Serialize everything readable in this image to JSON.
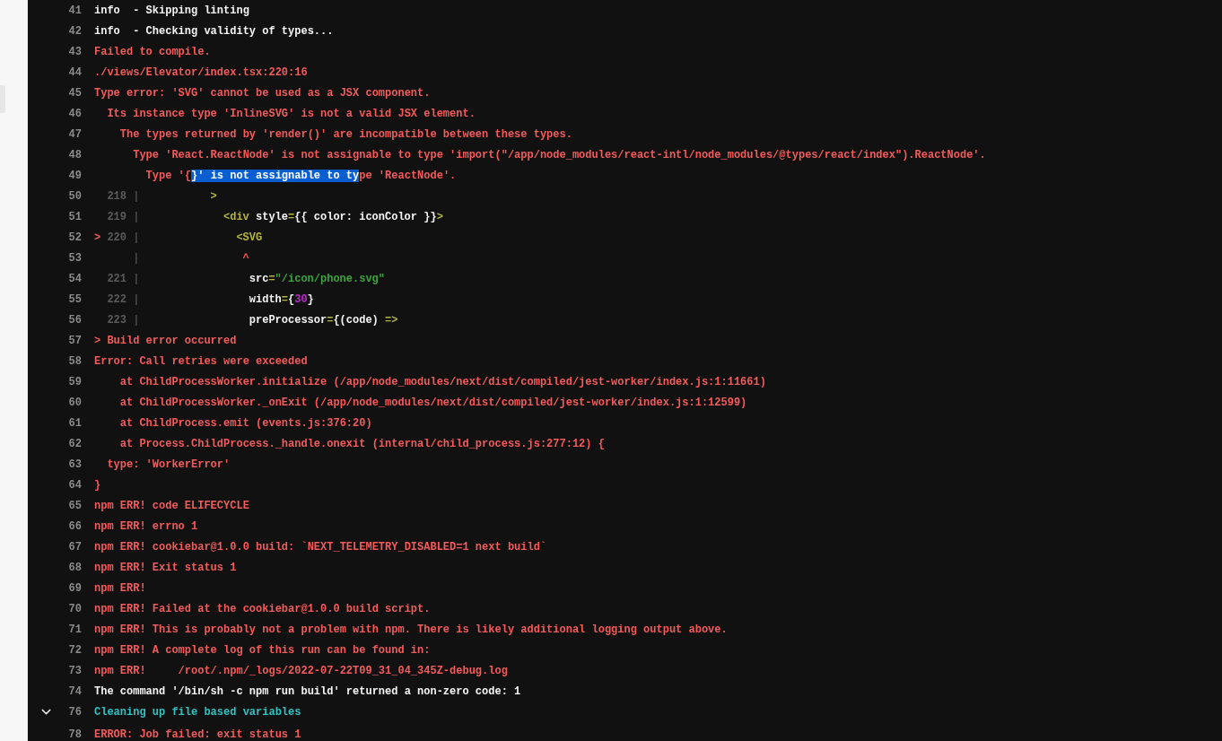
{
  "log": {
    "lines": [
      {
        "number": "41",
        "kind": "log",
        "parts": [
          {
            "text": "info  - Skipping linting",
            "kind": "white"
          }
        ]
      },
      {
        "number": "42",
        "kind": "log",
        "parts": [
          {
            "text": "info  - Checking validity of types...",
            "kind": "white"
          }
        ]
      },
      {
        "number": "43",
        "kind": "log",
        "parts": [
          {
            "text": "Failed to compile.",
            "kind": "red"
          }
        ]
      },
      {
        "number": "44",
        "kind": "log",
        "parts": [
          {
            "text": "./views/Elevator/index.tsx:220:16",
            "kind": "red"
          }
        ]
      },
      {
        "number": "45",
        "kind": "log",
        "parts": [
          {
            "text": "Type error: 'SVG' cannot be used as a JSX component.",
            "kind": "red"
          }
        ]
      },
      {
        "number": "46",
        "kind": "log",
        "parts": [
          {
            "text": "  Its instance type 'InlineSVG' is not a valid JSX element.",
            "kind": "red"
          }
        ]
      },
      {
        "number": "47",
        "kind": "log",
        "parts": [
          {
            "text": "    The types returned by 'render()' are incompatible between these types.",
            "kind": "red"
          }
        ]
      },
      {
        "number": "48",
        "kind": "log",
        "parts": [
          {
            "text": "      Type 'React.ReactNode' is not assignable to type 'import(\"/app/node_modules/react-intl/node_modules/@types/react/index\").ReactNode'.",
            "kind": "red"
          }
        ]
      },
      {
        "number": "49",
        "kind": "log",
        "parts": [
          {
            "text": "        Type '{",
            "kind": "red",
            "selected": false
          },
          {
            "text": "}' is not assignable to ty",
            "selected": true
          },
          {
            "text": "pe 'ReactNode'.",
            "kind": "red",
            "selected": false
          }
        ]
      },
      {
        "number": "50",
        "kind": "frame",
        "source_number": "218",
        "gutter": "|",
        "parts": [
          {
            "text": "          >",
            "kind": "punct"
          }
        ]
      },
      {
        "number": "51",
        "kind": "frame",
        "source_number": "219",
        "gutter": "|",
        "parts": [
          {
            "text": "            <div",
            "kind": "punct"
          },
          {
            "text": " style",
            "kind": "white"
          },
          {
            "text": "=",
            "kind": "punct"
          },
          {
            "text": "{{ color: iconColor }}",
            "kind": "white"
          },
          {
            "text": ">",
            "kind": "punct"
          }
        ]
      },
      {
        "number": "52",
        "kind": "frame",
        "pointer": ">",
        "source_number": "220",
        "gutter": "|",
        "parts": [
          {
            "text": "              <SVG",
            "kind": "punct"
          }
        ]
      },
      {
        "number": "53",
        "kind": "frame",
        "gutter": "|",
        "parts": [
          {
            "text": "               ^",
            "kind": "red"
          }
        ]
      },
      {
        "number": "54",
        "kind": "frame",
        "source_number": "221",
        "gutter": "|",
        "parts": [
          {
            "text": "                src",
            "kind": "white"
          },
          {
            "text": "=",
            "kind": "punct"
          },
          {
            "text": "\"/icon/phone.svg\"",
            "kind": "string"
          }
        ]
      },
      {
        "number": "55",
        "kind": "frame",
        "source_number": "222",
        "gutter": "|",
        "parts": [
          {
            "text": "                width",
            "kind": "white"
          },
          {
            "text": "=",
            "kind": "punct"
          },
          {
            "text": "{",
            "kind": "white"
          },
          {
            "text": "30",
            "kind": "number"
          },
          {
            "text": "}",
            "kind": "white"
          }
        ]
      },
      {
        "number": "56",
        "kind": "frame",
        "source_number": "223",
        "gutter": "|",
        "parts": [
          {
            "text": "                preProcessor",
            "kind": "white"
          },
          {
            "text": "=",
            "kind": "punct"
          },
          {
            "text": "{(code) ",
            "kind": "white"
          },
          {
            "text": "=>",
            "kind": "punct"
          }
        ]
      },
      {
        "number": "57",
        "kind": "log",
        "parts": [
          {
            "text": "> Build error occurred",
            "kind": "red"
          }
        ]
      },
      {
        "number": "58",
        "kind": "log",
        "parts": [
          {
            "text": "Error: Call retries were exceeded",
            "kind": "red"
          }
        ]
      },
      {
        "number": "59",
        "kind": "log",
        "parts": [
          {
            "text": "    at ChildProcessWorker.initialize (/app/node_modules/next/dist/compiled/jest-worker/index.js:1:11661)",
            "kind": "red"
          }
        ]
      },
      {
        "number": "60",
        "kind": "log",
        "parts": [
          {
            "text": "    at ChildProcessWorker._onExit (/app/node_modules/next/dist/compiled/jest-worker/index.js:1:12599)",
            "kind": "red"
          }
        ]
      },
      {
        "number": "61",
        "kind": "log",
        "parts": [
          {
            "text": "    at ChildProcess.emit (events.js:376:20)",
            "kind": "red"
          }
        ]
      },
      {
        "number": "62",
        "kind": "log",
        "parts": [
          {
            "text": "    at Process.ChildProcess._handle.onexit (internal/child_process.js:277:12) {",
            "kind": "red"
          }
        ]
      },
      {
        "number": "63",
        "kind": "log",
        "parts": [
          {
            "text": "  type: 'WorkerError'",
            "kind": "red"
          }
        ]
      },
      {
        "number": "64",
        "kind": "log",
        "parts": [
          {
            "text": "}",
            "kind": "red"
          }
        ]
      },
      {
        "number": "65",
        "kind": "log",
        "parts": [
          {
            "text": "npm ERR! code ELIFECYCLE",
            "kind": "red"
          }
        ]
      },
      {
        "number": "66",
        "kind": "log",
        "parts": [
          {
            "text": "npm ERR! errno 1",
            "kind": "red"
          }
        ]
      },
      {
        "number": "67",
        "kind": "log",
        "parts": [
          {
            "text": "npm ERR! cookiebar@1.0.0 build: `NEXT_TELEMETRY_DISABLED=1 next build`",
            "kind": "red"
          }
        ]
      },
      {
        "number": "68",
        "kind": "log",
        "parts": [
          {
            "text": "npm ERR! Exit status 1",
            "kind": "red"
          }
        ]
      },
      {
        "number": "69",
        "kind": "log",
        "parts": [
          {
            "text": "npm ERR!",
            "kind": "red"
          }
        ]
      },
      {
        "number": "70",
        "kind": "log",
        "parts": [
          {
            "text": "npm ERR! Failed at the cookiebar@1.0.0 build script.",
            "kind": "red"
          }
        ]
      },
      {
        "number": "71",
        "kind": "log",
        "parts": [
          {
            "text": "npm ERR! This is probably not a problem with npm. There is likely additional logging output above.",
            "kind": "red"
          }
        ]
      },
      {
        "number": "72",
        "kind": "log",
        "parts": [
          {
            "text": "npm ERR! A complete log of this run can be found in:",
            "kind": "red"
          }
        ]
      },
      {
        "number": "73",
        "kind": "log",
        "parts": [
          {
            "text": "npm ERR!     /root/.npm/_logs/2022-07-22T09_31_04_345Z-debug.log",
            "kind": "red"
          }
        ]
      },
      {
        "number": "74",
        "kind": "log",
        "parts": [
          {
            "text": "The command '/bin/sh -c npm run build' returned a non-zero code: 1",
            "kind": "white"
          }
        ]
      },
      {
        "number": "76",
        "kind": "section",
        "expanded": true,
        "parts": [
          {
            "text": "Cleaning up file based variables",
            "kind": "cyan"
          }
        ]
      },
      {
        "number": "78",
        "kind": "section_end",
        "parts": [
          {
            "text": "ERROR: Job failed: exit status 1",
            "kind": "red"
          }
        ]
      }
    ]
  }
}
